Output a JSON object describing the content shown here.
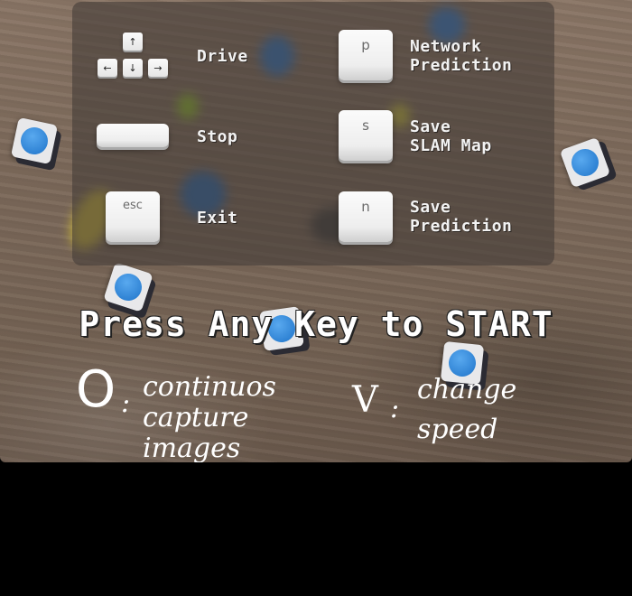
{
  "controls": {
    "left": [
      {
        "key": "",
        "label": "Drive",
        "icon": "arrow-keys-icon"
      },
      {
        "key": "",
        "label": "Stop",
        "icon": "spacebar-key-icon"
      },
      {
        "key": "esc",
        "label": "Exit",
        "icon": "esc-key-icon"
      }
    ],
    "right": [
      {
        "key": "p",
        "label": "Network\nPrediction"
      },
      {
        "key": "s",
        "label": "Save\nSLAM Map"
      },
      {
        "key": "n",
        "label": "Save\nPrediction"
      }
    ],
    "arrows": {
      "up": "↑",
      "left": "←",
      "down": "↓",
      "right": "→"
    }
  },
  "start_prompt": "Press Any Key to START",
  "handwritten": {
    "o_key": "O",
    "o_colon": ":",
    "o_desc": "continuos\ncapture\nimages",
    "v_key": "V",
    "v_colon": ":",
    "v_desc": "change\nspeed"
  },
  "colors": {
    "panel": "#463e38",
    "cube_face": "#2b7fd6",
    "text": "#f2f2f2"
  }
}
